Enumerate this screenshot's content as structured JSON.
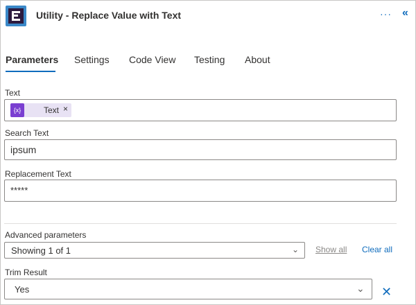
{
  "header": {
    "title": "Utility - Replace Value with Text",
    "more_label": "···",
    "collapse_label": "«"
  },
  "tabs": [
    {
      "label": "Parameters",
      "active": true
    },
    {
      "label": "Settings"
    },
    {
      "label": "Code View"
    },
    {
      "label": "Testing"
    },
    {
      "label": "About"
    }
  ],
  "fields": {
    "text": {
      "label": "Text",
      "token": {
        "icon": "{x}",
        "label": "Text",
        "close": "×"
      }
    },
    "search": {
      "label": "Search Text",
      "value": "ipsum"
    },
    "replacement": {
      "label": "Replacement Text",
      "value": "*****"
    }
  },
  "advanced": {
    "label": "Advanced parameters",
    "select_value": "Showing 1 of 1",
    "show_all": "Show all",
    "clear_all": "Clear all"
  },
  "trim": {
    "label": "Trim Result",
    "value": "Yes",
    "remove": "✕"
  },
  "colors": {
    "accent": "#0f6cbd",
    "token_bg": "#e8e2f4",
    "token_icon": "#7a3fd1",
    "logo_bg": "#3a88c8"
  }
}
